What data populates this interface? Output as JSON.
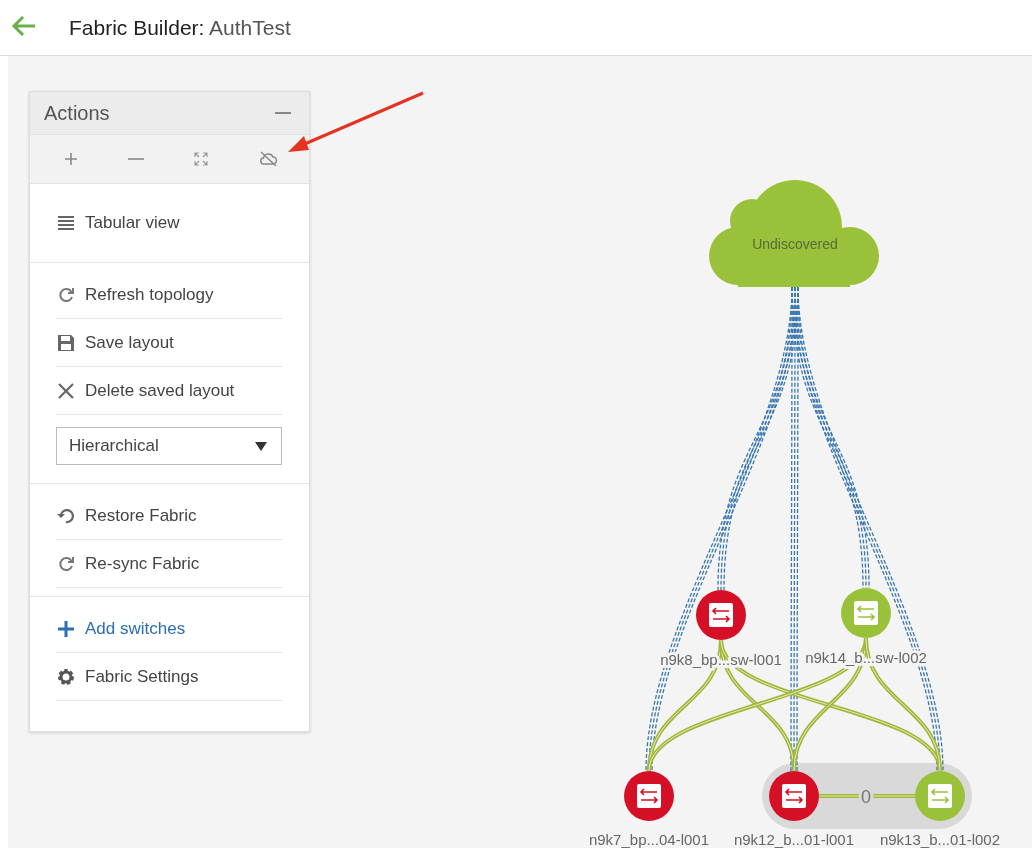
{
  "header": {
    "title": "Fabric Builder:",
    "fabric": "AuthTest"
  },
  "panel": {
    "title": "Actions",
    "sections": [
      [
        {
          "kind": "action",
          "label": "Tabular view"
        }
      ],
      [
        {
          "kind": "action",
          "label": "Refresh topology"
        },
        {
          "kind": "action",
          "label": "Save layout"
        },
        {
          "kind": "action",
          "label": "Delete saved layout"
        },
        {
          "kind": "select",
          "value": "Hierarchical"
        }
      ],
      [
        {
          "kind": "action",
          "label": "Restore Fabric"
        },
        {
          "kind": "action",
          "label": "Re-sync Fabric"
        }
      ],
      [
        {
          "kind": "link",
          "label": "Add switches"
        },
        {
          "kind": "action",
          "label": "Fabric Settings"
        }
      ]
    ]
  },
  "topology": {
    "cloud": {
      "label": "Undiscovered"
    },
    "nodes": [
      {
        "label": "n9k8_bp...sw-l001",
        "color": "#d50f25"
      },
      {
        "label": "n9k14_b...sw-l002",
        "color": "#99c23a"
      },
      {
        "label": "n9k7_bp...04-l001",
        "color": "#d50f25"
      },
      {
        "label": "n9k12_b...01-l001",
        "color": "#d50f25"
      },
      {
        "label": "n9k13_b...01-l002",
        "color": "#99c23a"
      }
    ],
    "pair_link": {
      "label": "0"
    }
  }
}
